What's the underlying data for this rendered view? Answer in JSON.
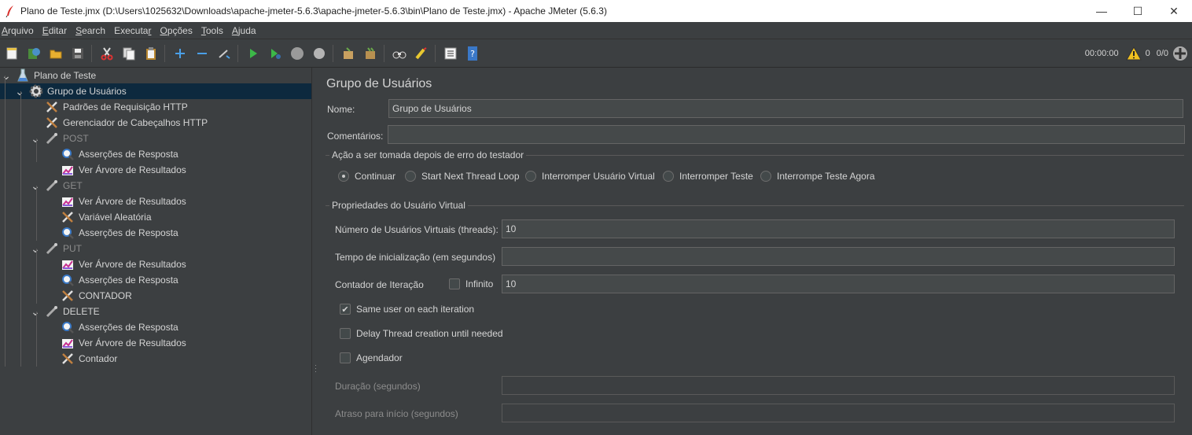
{
  "window": {
    "title": "Plano de Teste.jmx (D:\\Users\\1025632\\Downloads\\apache-jmeter-5.6.3\\apache-jmeter-5.6.3\\bin\\Plano de Teste.jmx) - Apache JMeter (5.6.3)",
    "controls": [
      "—",
      "☐",
      "✕"
    ]
  },
  "menu": [
    {
      "label": "Arquivo",
      "u": "A",
      "rest": "rquivo"
    },
    {
      "label": "Editar",
      "u": "E",
      "rest": "ditar"
    },
    {
      "label": "Search",
      "u": "S",
      "rest": "earch"
    },
    {
      "label": "Executar",
      "pre": "Executa",
      "u": "r"
    },
    {
      "label": "Opções",
      "u": "O",
      "rest": "pções"
    },
    {
      "label": "Tools",
      "u": "T",
      "rest": "ools"
    },
    {
      "label": "Ajuda",
      "u": "A",
      "rest": "juda"
    }
  ],
  "toolbar": {
    "timer": "00:00:00",
    "warnings": "0",
    "threads": "0/0"
  },
  "tree": [
    {
      "label": "Plano de Teste",
      "level": 0,
      "icon": "flask-icon",
      "expanded": true
    },
    {
      "label": "Grupo de Usuários",
      "level": 1,
      "icon": "gear-icon",
      "expanded": true,
      "selected": true
    },
    {
      "label": "Padrões de Requisição HTTP",
      "level": 2,
      "icon": "wrench-icon"
    },
    {
      "label": "Gerenciador de Cabeçalhos HTTP",
      "level": 2,
      "icon": "wrench-icon"
    },
    {
      "label": "POST",
      "level": 2,
      "icon": "sampler-icon",
      "expanded": true,
      "disabled": true
    },
    {
      "label": "Asserções de Resposta",
      "level": 3,
      "icon": "assertion-icon"
    },
    {
      "label": "Ver Árvore de Resultados",
      "level": 3,
      "icon": "listener-icon"
    },
    {
      "label": "GET",
      "level": 2,
      "icon": "sampler-icon",
      "expanded": true,
      "disabled": true
    },
    {
      "label": "Ver Árvore de Resultados",
      "level": 3,
      "icon": "listener-icon"
    },
    {
      "label": "Variável Aleatória",
      "level": 3,
      "icon": "wrench-icon"
    },
    {
      "label": "Asserções de Resposta",
      "level": 3,
      "icon": "assertion-icon"
    },
    {
      "label": "PUT",
      "level": 2,
      "icon": "sampler-icon",
      "expanded": true,
      "disabled": true
    },
    {
      "label": "Ver Árvore de Resultados",
      "level": 3,
      "icon": "listener-icon"
    },
    {
      "label": "Asserções de Resposta",
      "level": 3,
      "icon": "assertion-icon"
    },
    {
      "label": "CONTADOR",
      "level": 3,
      "icon": "wrench-icon"
    },
    {
      "label": "DELETE",
      "level": 2,
      "icon": "sampler-icon",
      "expanded": true
    },
    {
      "label": "Asserções de Resposta",
      "level": 3,
      "icon": "assertion-icon"
    },
    {
      "label": "Ver Árvore de Resultados",
      "level": 3,
      "icon": "listener-icon"
    },
    {
      "label": "Contador",
      "level": 3,
      "icon": "wrench-icon"
    }
  ],
  "panel": {
    "title": "Grupo de Usuários",
    "name_label": "Nome:",
    "name_value": "Grupo de Usuários",
    "comments_label": "Comentários:",
    "comments_value": "",
    "error_group_title": "Ação a ser tomada depois de erro do testador",
    "error_actions": [
      {
        "label": "Continuar",
        "selected": true
      },
      {
        "label": "Start Next Thread Loop",
        "selected": false
      },
      {
        "label": "Interromper Usuário Virtual",
        "selected": false
      },
      {
        "label": "Interromper Teste",
        "selected": false
      },
      {
        "label": "Interrompe Teste Agora",
        "selected": false
      }
    ],
    "props_group_title": "Propriedades do Usuário Virtual",
    "threads_label": "Número de Usuários Virtuais (threads):",
    "threads_value": "10",
    "rampup_label": "Tempo de inicialização (em segundos)",
    "rampup_value": "",
    "loop_label": "Contador de Iteração",
    "infinite_label": "Infinito",
    "infinite_checked": false,
    "loop_value": "10",
    "same_user_label": "Same user on each iteration",
    "same_user_checked": true,
    "delay_label": "Delay Thread creation until needed",
    "delay_checked": false,
    "scheduler_label": "Agendador",
    "scheduler_checked": false,
    "duration_label": "Duração (segundos)",
    "duration_value": "",
    "delay_start_label": "Atraso para início (segundos)",
    "delay_start_value": ""
  }
}
